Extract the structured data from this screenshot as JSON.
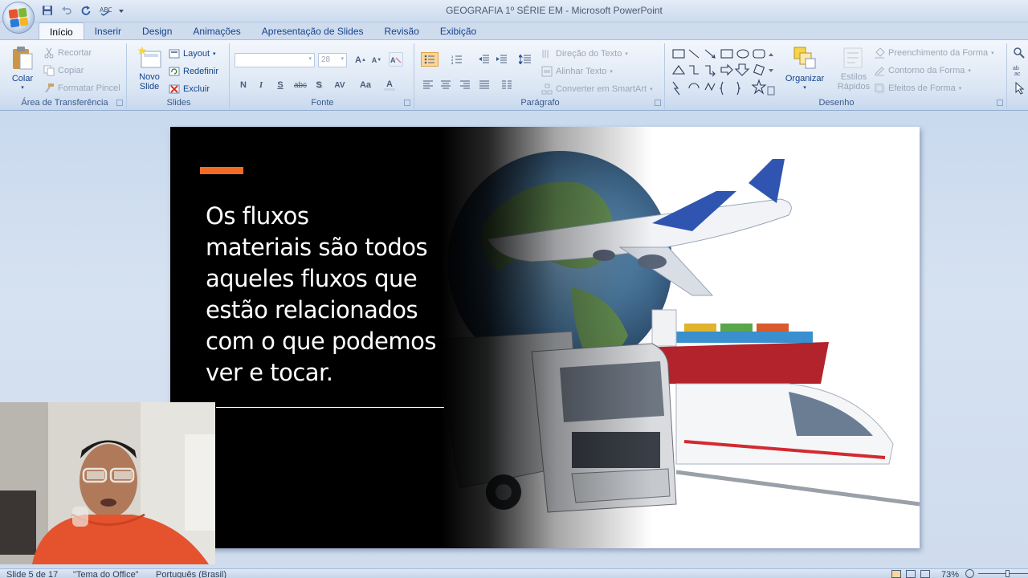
{
  "window": {
    "title": "GEOGRAFIA 1º SÉRIE EM - Microsoft PowerPoint"
  },
  "tabs": [
    "Início",
    "Inserir",
    "Design",
    "Animações",
    "Apresentação de Slides",
    "Revisão",
    "Exibição"
  ],
  "clipboard": {
    "paste": "Colar",
    "cut": "Recortar",
    "copy": "Copiar",
    "format_painter": "Formatar Pincel",
    "label": "Área de Transferência"
  },
  "slides": {
    "new_slide_line1": "Novo",
    "new_slide_line2": "Slide",
    "layout": "Layout",
    "reset": "Redefinir",
    "delete": "Excluir",
    "label": "Slides"
  },
  "font": {
    "size": "28",
    "label": "Fonte",
    "bold": "N",
    "italic": "I",
    "underline": "S",
    "strike": "abc",
    "shadow": "S",
    "spacing": "AV",
    "case": "Aa",
    "color": "A"
  },
  "paragraph": {
    "text_direction": "Direção do Texto",
    "align_text": "Alinhar Texto",
    "smartart": "Converter em SmartArt",
    "label": "Parágrafo"
  },
  "drawing": {
    "arrange": "Organizar",
    "quick_styles_line1": "Estilos",
    "quick_styles_line2": "Rápidos",
    "shape_fill": "Preenchimento da Forma",
    "shape_outline": "Contorno da Forma",
    "shape_effects": "Efeitos de Forma",
    "label": "Desenho"
  },
  "slide": {
    "text_lines": [
      "Os fluxos",
      "materiais são todos",
      "aqueles fluxos que",
      "estão relacionados",
      "com o que podemos",
      "ver e tocar."
    ]
  },
  "status": {
    "slide_count": "Slide 5 de 17",
    "theme": "\"Tema do Office\"",
    "language": "Português (Brasil)",
    "zoom": "73%"
  }
}
